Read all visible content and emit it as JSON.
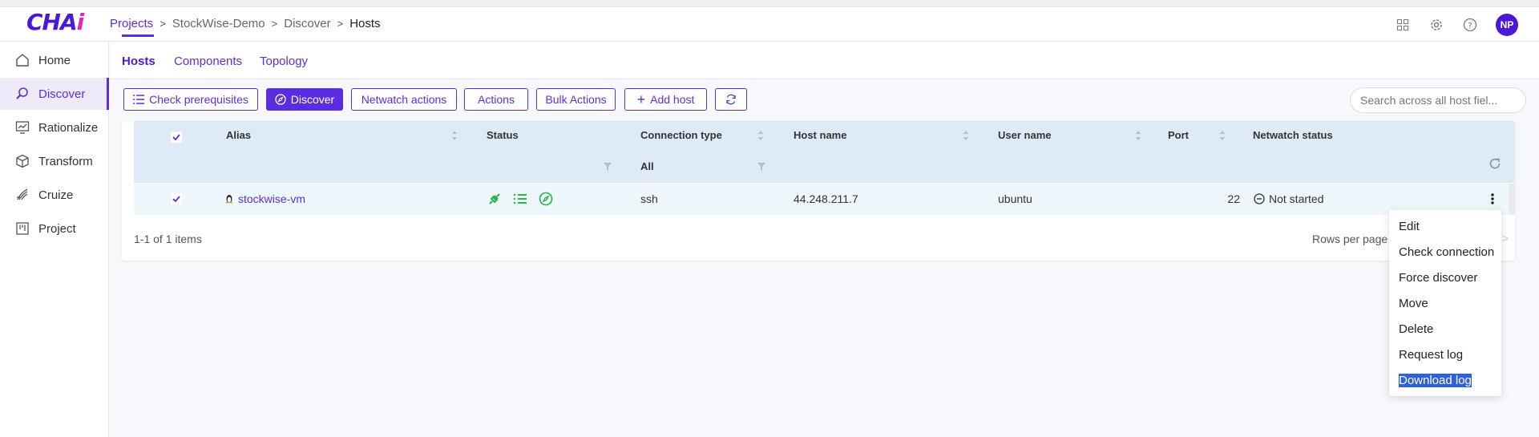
{
  "app": {
    "logo_main": "CHA",
    "logo_accent": "i"
  },
  "breadcrumb": [
    "Projects",
    "StockWise-Demo",
    "Discover",
    "Hosts"
  ],
  "header": {
    "avatar_initials": "NP"
  },
  "sidebar": {
    "items": [
      {
        "label": "Home",
        "icon": "home-icon",
        "active": false
      },
      {
        "label": "Discover",
        "icon": "discover-icon",
        "active": true
      },
      {
        "label": "Rationalize",
        "icon": "rationalize-icon",
        "active": false
      },
      {
        "label": "Transform",
        "icon": "transform-icon",
        "active": false
      },
      {
        "label": "Cruize",
        "icon": "cruize-icon",
        "active": false
      },
      {
        "label": "Project",
        "icon": "project-icon",
        "active": false
      }
    ]
  },
  "tabs": [
    {
      "label": "Hosts",
      "active": true
    },
    {
      "label": "Components",
      "active": false
    },
    {
      "label": "Topology",
      "active": false
    }
  ],
  "toolbar": {
    "check_prerequisites": "Check prerequisites",
    "discover": "Discover",
    "netwatch_actions": "Netwatch actions",
    "actions": "Actions",
    "bulk_actions": "Bulk Actions",
    "add_host": "Add host"
  },
  "search": {
    "placeholder": "Search across all host fiel..."
  },
  "table": {
    "columns": [
      "Alias",
      "Status",
      "Connection type",
      "Host name",
      "User name",
      "Port",
      "Netwatch status"
    ],
    "connection_filter": "All",
    "rows": [
      {
        "alias": "stockwise-vm",
        "connection_type": "ssh",
        "host_name": "44.248.211.7",
        "user_name": "ubuntu",
        "port": "22",
        "netwatch_status": "Not started",
        "selected": true
      }
    ],
    "footer_count": "1-1 of 1 items",
    "rows_per_page": "Rows per page"
  },
  "context_menu": {
    "items": [
      "Edit",
      "Check connection",
      "Force discover",
      "Move",
      "Delete",
      "Request log",
      "Download log"
    ],
    "highlighted": "Download log"
  },
  "colors": {
    "accent": "#5a2ee0",
    "status_green": "#2ab14a",
    "header_bg": "#deebf6",
    "highlight": "#2f61d6"
  }
}
